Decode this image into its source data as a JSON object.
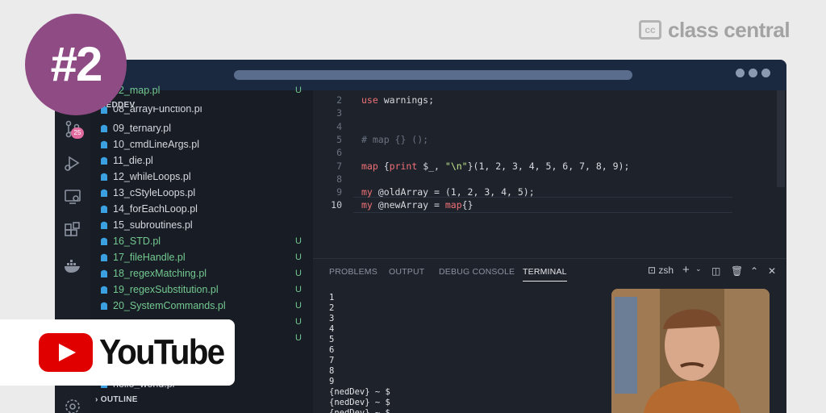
{
  "brand": {
    "logo_mark": "cc",
    "logo_text": "class central"
  },
  "episode_badge": "#2",
  "youtube": {
    "label": "YouTube"
  },
  "activity_bar": {
    "scm_badge": "25"
  },
  "sidebar": {
    "partial_top": "22_map.pl",
    "partial_top_status": "U",
    "section_title": "NEDDEV",
    "partial_second": "08_arrayFunction.pl",
    "files": [
      {
        "name": "09_ternary.pl",
        "status": ""
      },
      {
        "name": "10_cmdLineArgs.pl",
        "status": ""
      },
      {
        "name": "11_die.pl",
        "status": ""
      },
      {
        "name": "12_whileLoops.pl",
        "status": ""
      },
      {
        "name": "13_cStyleLoops.pl",
        "status": ""
      },
      {
        "name": "14_forEachLoop.pl",
        "status": ""
      },
      {
        "name": "15_subroutines.pl",
        "status": ""
      },
      {
        "name": "16_STD.pl",
        "status": "U"
      },
      {
        "name": "17_fileHandle.pl",
        "status": "U"
      },
      {
        "name": "18_regexMatching.pl",
        "status": "U"
      },
      {
        "name": "19_regexSubstitution.pl",
        "status": "U"
      },
      {
        "name": "20_SystemCommands.pl",
        "status": "U"
      }
    ],
    "hidden_status_1": "U",
    "hidden_status_2": "U",
    "partial_bottom": "hello_world.pl",
    "outline_label": "OUTLINE"
  },
  "editor": {
    "lines": [
      {
        "num": "2",
        "text": "use warnings;"
      },
      {
        "num": "3",
        "text": ""
      },
      {
        "num": "4",
        "text": ""
      },
      {
        "num": "5",
        "text": "# map {} ();"
      },
      {
        "num": "6",
        "text": ""
      },
      {
        "num": "7",
        "text": "map {print $_, \"\\n\"}(1, 2, 3, 4, 5, 6, 7, 8, 9);"
      },
      {
        "num": "8",
        "text": ""
      },
      {
        "num": "9",
        "text": "my @oldArray = (1, 2, 3, 4, 5);"
      },
      {
        "num": "10",
        "text": "my @newArray = map{}"
      }
    ]
  },
  "panel": {
    "tabs": [
      "PROBLEMS",
      "OUTPUT",
      "DEBUG CONSOLE",
      "TERMINAL"
    ],
    "active_tab": "TERMINAL",
    "shell": "zsh",
    "terminal_output": "1\n2\n3\n4\n5\n6\n7\n8\n9\n{nedDev} ~ $\n{nedDev} ~ $\n{nedDev} ~ $"
  }
}
